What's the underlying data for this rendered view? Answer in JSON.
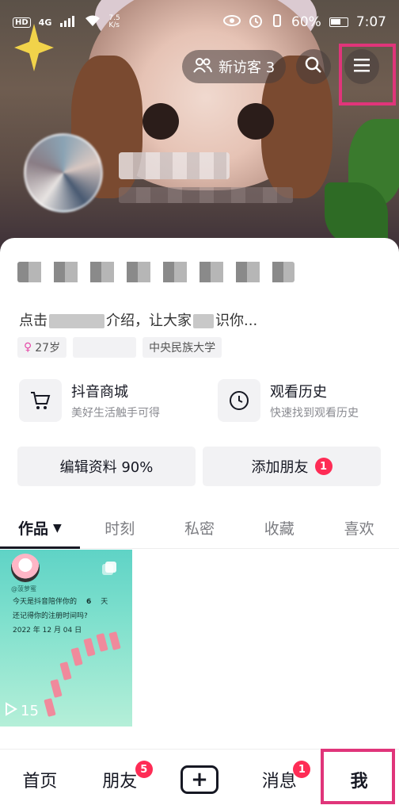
{
  "status_bar": {
    "hd": "HD",
    "network": "4G",
    "speed_value": "7.5",
    "speed_unit": "K/s",
    "battery": "60%",
    "time": "7:07"
  },
  "header": {
    "visitors_label": "新访客 3"
  },
  "profile": {
    "bio_prefix": "点击",
    "bio_middle": "介绍，让大家",
    "bio_suffix": "识你...",
    "tags": [
      "27岁",
      "",
      "中央民族大学"
    ]
  },
  "quick_links": [
    {
      "title": "抖音商城",
      "subtitle": "美好生活触手可得",
      "icon": "cart-icon"
    },
    {
      "title": "观看历史",
      "subtitle": "快速找到观看历史",
      "icon": "clock-icon"
    }
  ],
  "buttons": {
    "edit_profile": "编辑资料 90%",
    "add_friends": "添加朋友",
    "add_friends_badge": "1"
  },
  "tabs": [
    "作品",
    "时刻",
    "私密",
    "收藏",
    "喜欢"
  ],
  "video": {
    "author": "@菠萝蜜",
    "line1_prefix": "今天是抖音陪伴你的",
    "line1_num": "6",
    "line1_suffix": "天",
    "line2": "还记得你的注册时间吗?",
    "line3": "2022 年 12 月 04 日",
    "plays": "15"
  },
  "bottom_nav": {
    "home": "首页",
    "friends": "朋友",
    "friends_badge": "5",
    "create": "+",
    "messages": "消息",
    "messages_badge": "1",
    "me": "我"
  },
  "colors": {
    "accent_badge": "#fe2c55",
    "highlight_box": "#e0357a"
  }
}
